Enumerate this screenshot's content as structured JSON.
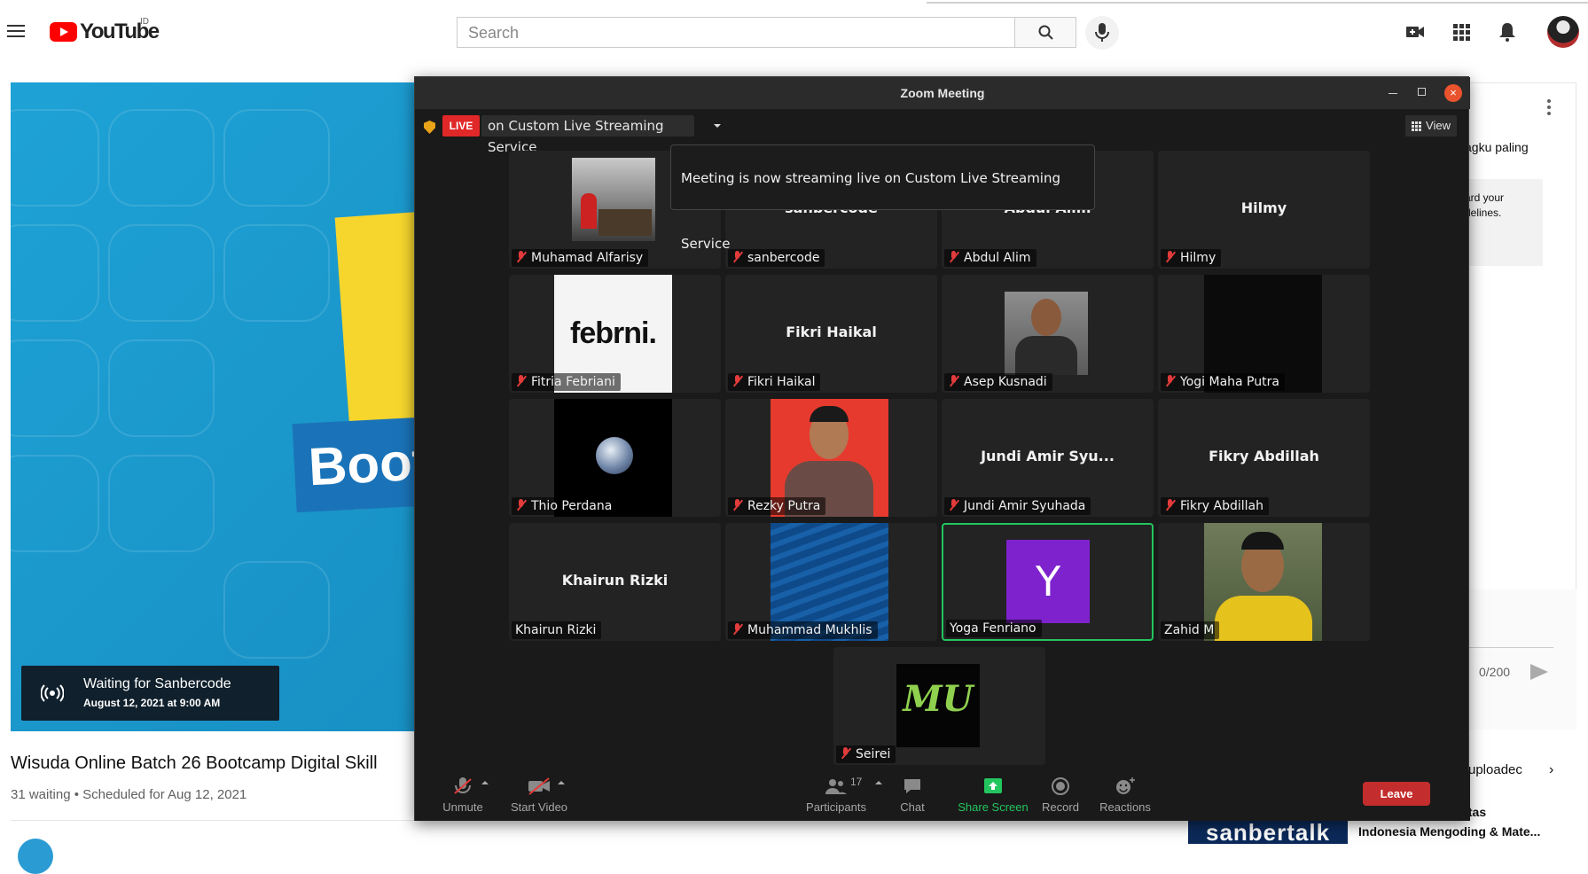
{
  "youtube": {
    "country_code": "ID",
    "logo_text": "YouTube",
    "search_placeholder": "Search",
    "video_title": "Wisuda Online Batch 26 Bootcamp Digital Skill",
    "video_meta": "31 waiting • Scheduled for Aug 12, 2021",
    "waiting_title": "Waiting for Sanbercode",
    "waiting_date": "August 12, 2021 at 9:00 AM",
    "thumb_text": "Boot",
    "chat_text1": "agku paling",
    "chat_notice_line1": "ard your",
    "chat_notice_line2": "delines.",
    "chat_count": "0/200",
    "uploaded_text": "uploadec",
    "rec_title1": "itas",
    "rec_title2": "Indonesia Mengoding & Mate...",
    "thumb_bottom_text": "sanbertalk"
  },
  "zoom": {
    "window_title": "Zoom Meeting",
    "live_badge": "LIVE",
    "live_service": "on Custom Live Streaming Service",
    "view_label": "View",
    "tooltip": "Meeting is now streaming live on Custom Live Streaming Service",
    "tiles": [
      {
        "name": "Muhamad Alfarisy",
        "center": "",
        "muted": true
      },
      {
        "name": "sanbercode",
        "center": "sanbercode",
        "muted": true
      },
      {
        "name": "Abdul Alim",
        "center": "Abdul Alim",
        "muted": true
      },
      {
        "name": "Hilmy",
        "center": "Hilmy",
        "muted": true
      },
      {
        "name": "Fitria Febriani",
        "center": "",
        "muted": true,
        "img_text": "febrni."
      },
      {
        "name": "Fikri Haikal",
        "center": "Fikri Haikal",
        "muted": true
      },
      {
        "name": "Asep Kusnadi",
        "center": "",
        "muted": true
      },
      {
        "name": "Yogi Maha Putra",
        "center": "",
        "muted": true
      },
      {
        "name": "Thio Perdana",
        "center": "",
        "muted": true
      },
      {
        "name": "Rezky Putra",
        "center": "",
        "muted": true
      },
      {
        "name": "Jundi Amir Syuhada",
        "center": "Jundi Amir Syu...",
        "muted": true
      },
      {
        "name": "Fikry Abdillah",
        "center": "Fikry Abdillah",
        "muted": true
      },
      {
        "name": "Khairun Rizki",
        "center": "Khairun Rizki",
        "muted": false
      },
      {
        "name": "Muhammad Mukhlis",
        "center": "",
        "muted": true
      },
      {
        "name": "Yoga Fenriano",
        "center": "",
        "muted": false,
        "avatar_letter": "Y"
      },
      {
        "name": "Zahid M",
        "center": "",
        "muted": false
      },
      {
        "name": "Seirei",
        "center": "",
        "muted": true,
        "img_text": "MU"
      }
    ],
    "toolbar": {
      "unmute": "Unmute",
      "start_video": "Start Video",
      "participants": "Participants",
      "participants_count": "17",
      "chat": "Chat",
      "share_screen": "Share Screen",
      "record": "Record",
      "reactions": "Reactions",
      "leave": "Leave"
    },
    "colors": {
      "live_red": "#e02828",
      "active_speaker_green": "#23c55e",
      "leave_red": "#c42d2d",
      "avatar_purple": "#7e22ce"
    }
  }
}
